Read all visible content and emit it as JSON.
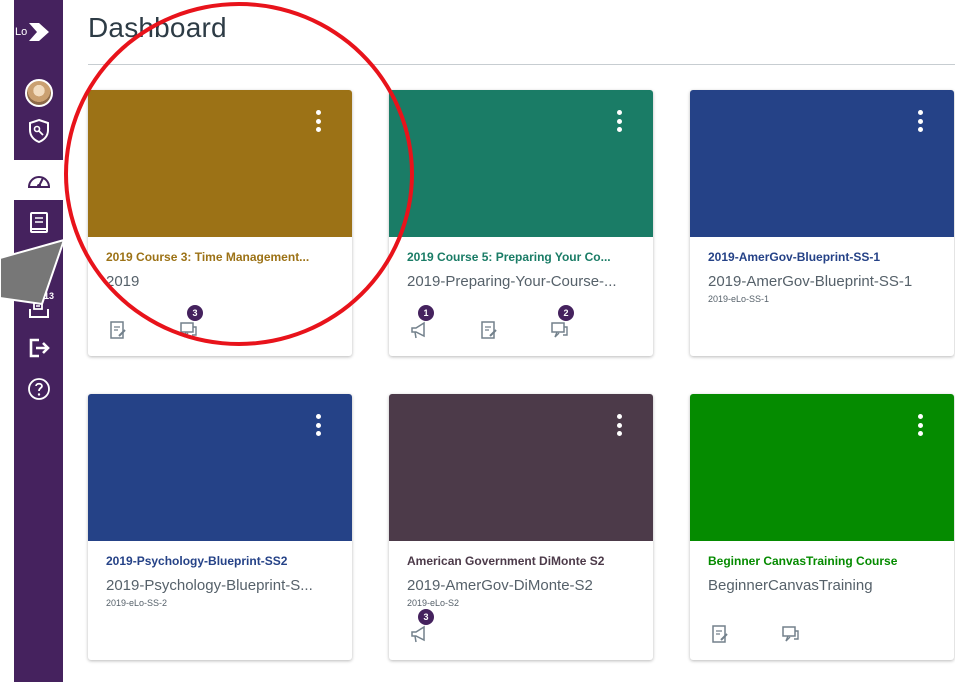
{
  "nav": {
    "logo_text": "Lo",
    "inbox_badge": "13",
    "items": [
      "avatar",
      "admin-icon",
      "dashboard-icon",
      "courses-icon",
      "calendar-icon",
      "inbox-icon",
      "commons-icon",
      "help-icon"
    ]
  },
  "header": {
    "title": "Dashboard"
  },
  "cards": [
    {
      "name": "2019 Course 3: Time Management...",
      "code": "2019",
      "term": "",
      "color": "#9c7216",
      "icons": [
        {
          "type": "assignments-icon",
          "badge": ""
        },
        {
          "type": "discussions-icon",
          "badge": "3"
        }
      ]
    },
    {
      "name": "2019 Course 5: Preparing Your Co...",
      "code": "2019-Preparing-Your-Course-...",
      "term": "",
      "color": "#1a7c66",
      "icons": [
        {
          "type": "announcements-icon",
          "badge": "1"
        },
        {
          "type": "assignments-icon",
          "badge": ""
        },
        {
          "type": "discussions-icon",
          "badge": "2"
        }
      ]
    },
    {
      "name": "2019-AmerGov-Blueprint-SS-1",
      "code": "2019-AmerGov-Blueprint-SS-1",
      "term": "2019-eLo-SS-1",
      "color": "#254287",
      "icons": []
    },
    {
      "name": "2019-Psychology-Blueprint-SS2",
      "code": "2019-Psychology-Blueprint-S...",
      "term": "2019-eLo-SS-2",
      "color": "#254287",
      "icons": []
    },
    {
      "name": "American Government DiMonte S2",
      "code": "2019-AmerGov-DiMonte-S2",
      "term": "2019-eLo-S2",
      "color": "#4c3a49",
      "icons": [
        {
          "type": "announcements-icon",
          "badge": "3"
        }
      ]
    },
    {
      "name": "Beginner CanvasTraining Course",
      "code": "BeginnerCanvasTraining",
      "term": "",
      "color": "#058b00",
      "icons": [
        {
          "type": "assignments-icon",
          "badge": ""
        },
        {
          "type": "discussions-icon",
          "badge": ""
        }
      ]
    }
  ],
  "colors": {
    "nav_bg": "#45225e",
    "annotation": "#e8131b",
    "arrow": "#777777"
  }
}
